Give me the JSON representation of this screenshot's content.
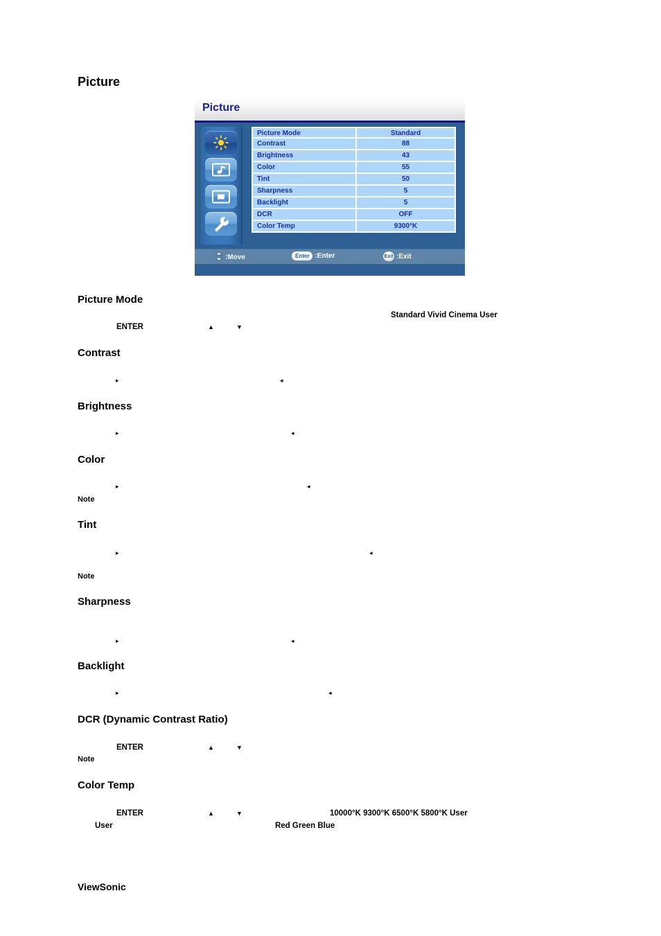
{
  "page": {
    "title": "Picture",
    "brand": "ViewSonic"
  },
  "osd": {
    "title": "Picture",
    "accent_navy": "#1a1f8f",
    "panel_blue": "#2e6094",
    "row_blue": "#aed6fb",
    "footer_blue": "#5e85a8",
    "icons": [
      {
        "name": "sun-icon",
        "label": "Picture",
        "selected": true
      },
      {
        "name": "music-note-icon",
        "label": "Audio",
        "selected": false
      },
      {
        "name": "screen-icon",
        "label": "Screen",
        "selected": false
      },
      {
        "name": "wrench-icon",
        "label": "Setup",
        "selected": false
      }
    ],
    "rows": [
      {
        "label": "Picture Mode",
        "value": "Standard"
      },
      {
        "label": "Contrast",
        "value": "88"
      },
      {
        "label": "Brightness",
        "value": "43"
      },
      {
        "label": "Color",
        "value": "55"
      },
      {
        "label": "Tint",
        "value": "50"
      },
      {
        "label": "Sharpness",
        "value": "5"
      },
      {
        "label": "Backlight",
        "value": "5"
      },
      {
        "label": "DCR",
        "value": "OFF"
      },
      {
        "label": "Color Temp",
        "value": "9300°K"
      }
    ],
    "footer": {
      "move_icon": "up-down-arrow-icon",
      "move_label": ":Move",
      "enter_badge": "Enter",
      "enter_label": ":Enter",
      "exit_badge": "Exit",
      "exit_label": ":Exit"
    }
  },
  "sections": [
    {
      "heading": "Picture Mode",
      "options": "Standard  Vivid  Cinema      User",
      "key_label": "ENTER",
      "arrows": "up-down"
    },
    {
      "heading": "Contrast",
      "arrows": "right-left"
    },
    {
      "heading": "Brightness",
      "arrows": "right-left"
    },
    {
      "heading": "Color",
      "arrows": "right-left",
      "note": "Note"
    },
    {
      "heading": "Tint",
      "arrows": "right-left",
      "note": "Note"
    },
    {
      "heading": "Sharpness",
      "arrows": "right-left"
    },
    {
      "heading": "Backlight",
      "arrows": "right-left"
    },
    {
      "heading": "DCR (Dynamic Contrast Ratio)",
      "key_label": "ENTER",
      "arrows": "up-down",
      "note": "Note"
    },
    {
      "heading": "Color Temp",
      "key_label": "ENTER",
      "arrows": "up-down",
      "options": "10000°K  9300°K  6500°K  5800°K     User",
      "sub_user": "User",
      "sub_channels": "Red  Green      Blue"
    }
  ]
}
